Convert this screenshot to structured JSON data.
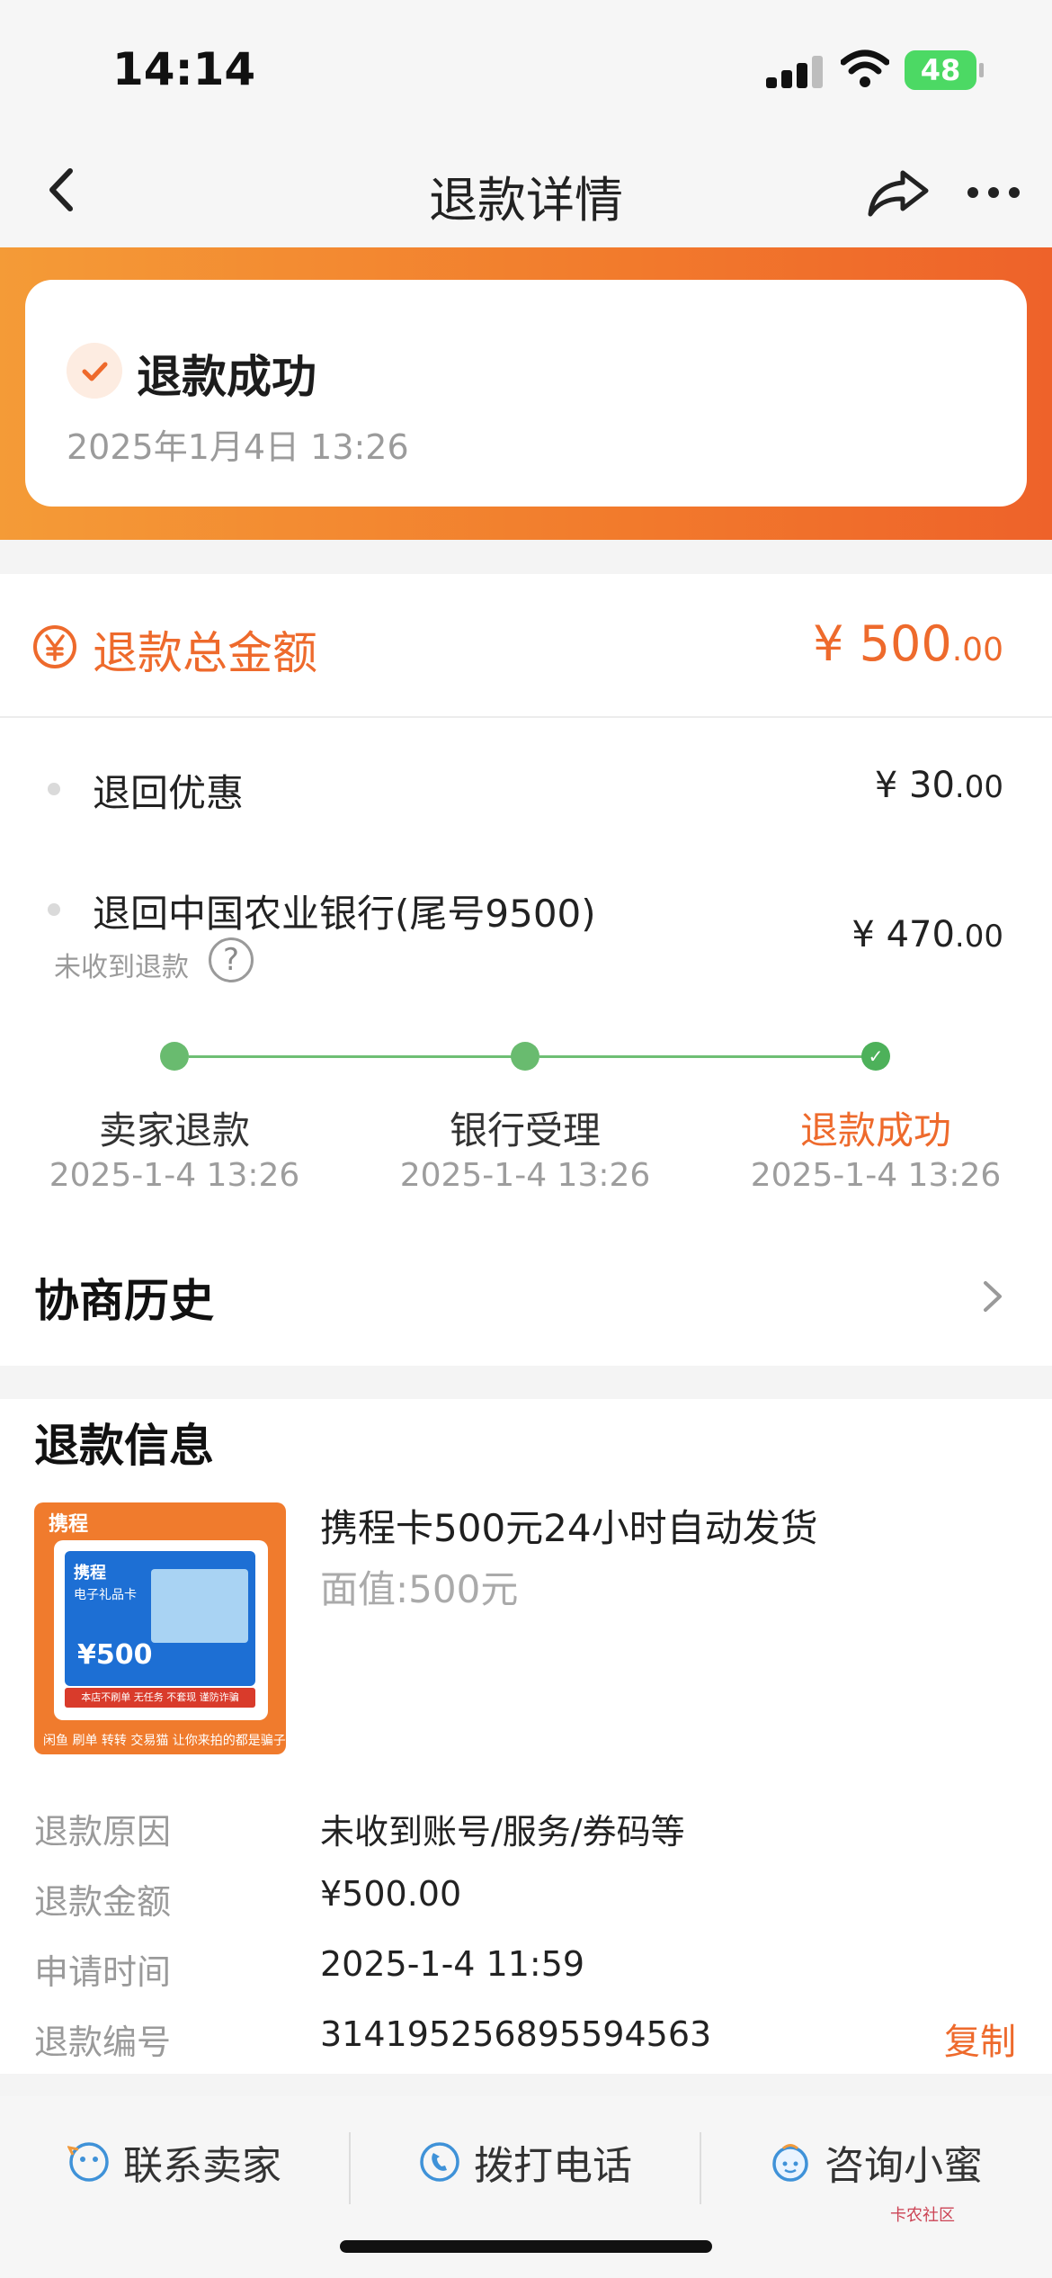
{
  "status_bar": {
    "time": "14:14",
    "battery": "48"
  },
  "nav": {
    "title": "退款详情"
  },
  "refund_status": {
    "title": "退款成功",
    "time": "2025年1月4日 13:26"
  },
  "total": {
    "label": "退款总金额",
    "currency": "¥",
    "int": "500",
    "dec": ".00"
  },
  "lines": [
    {
      "label": "退回优惠",
      "currency": "¥",
      "int": "30",
      "dec": ".00"
    },
    {
      "label": "退回中国农业银行(尾号9500)",
      "currency": "¥",
      "int": "470",
      "dec": ".00",
      "note": "未收到退款",
      "help": "?"
    }
  ],
  "timeline": [
    {
      "label": "卖家退款",
      "time": "2025-1-4 13:26"
    },
    {
      "label": "银行受理",
      "time": "2025-1-4 13:26"
    },
    {
      "label": "退款成功",
      "time": "2025-1-4 13:26"
    }
  ],
  "history": {
    "title": "协商历史"
  },
  "info": {
    "title": "退款信息",
    "product": {
      "name": "携程卡500元24小时自动发货",
      "face_value": "面值:500元",
      "image": {
        "brand": "携程",
        "card_brand": "携程",
        "card_title": "电子礼品卡",
        "price": "¥500",
        "warning": "本店不刷单 无任务 不套现 谨防诈骗",
        "footer": "闲鱼 刷单 转转 交易猫 让你来拍的都是骗子"
      }
    },
    "rows": [
      {
        "key": "退款原因",
        "value": "未收到账号/服务/券码等"
      },
      {
        "key": "退款金额",
        "value": "¥500.00"
      },
      {
        "key": "申请时间",
        "value": "2025-1-4 11:59"
      },
      {
        "key": "退款编号",
        "value": "314195256895594563",
        "action": "复制"
      }
    ]
  },
  "actions": [
    {
      "label": "联系卖家",
      "icon": "chat-face-icon"
    },
    {
      "label": "拨打电话",
      "icon": "phone-icon"
    },
    {
      "label": "咨询小蜜",
      "icon": "assistant-icon"
    }
  ],
  "watermark": "卡农社区",
  "colors": {
    "accent": "#ee6a2c",
    "success": "#69bb6f",
    "banner_start": "#f49b37",
    "banner_end": "#ee622a"
  }
}
